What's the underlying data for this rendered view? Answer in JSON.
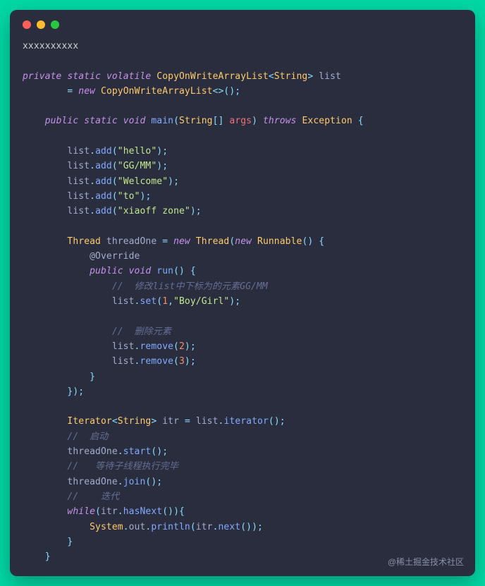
{
  "titlebar": {
    "dots": [
      "red",
      "yellow",
      "green"
    ]
  },
  "watermark": "@稀土掘金技术社区",
  "code": {
    "l1": "xxxxxxxxxx",
    "l2_private": "private",
    "l2_static": "static",
    "l2_volatile": "volatile",
    "l2_type": "CopyOnWriteArrayList",
    "l2_generic": "String",
    "l2_var": "list",
    "l3_new": "new",
    "l3_type": "CopyOnWriteArrayList",
    "l4_public": "public",
    "l4_static": "static",
    "l4_void": "void",
    "l4_main": "main",
    "l4_argtype": "String",
    "l4_argname": "args",
    "l4_throws": "throws",
    "l4_exc": "Exception",
    "add": "add",
    "s_hello": "\"hello\"",
    "s_ggmm": "\"GG/MM\"",
    "s_welcome": "\"Welcome\"",
    "s_to": "\"to\"",
    "s_xiaoff": "\"xiaoff zone\"",
    "thread_type": "Thread",
    "thread_var": "threadOne",
    "runnable": "Runnable",
    "override": "@Override",
    "run": "run",
    "cmt_modify": "//  修改list中下标为的元素GG/MM",
    "set": "set",
    "n1": "1",
    "s_boygirl": "\"Boy/Girl\"",
    "cmt_remove": "//  删除元素",
    "remove": "remove",
    "n2": "2",
    "n3": "3",
    "iter_type": "Iterator",
    "iter_var": "itr",
    "iterator": "iterator",
    "cmt_start": "//  启动",
    "start": "start",
    "cmt_wait": "//   等待子线程执行完毕",
    "join": "join",
    "cmt_iter": "//    迭代",
    "while": "while",
    "hasnext": "hasNext",
    "system": "System",
    "out": "out",
    "println": "println",
    "next": "next",
    "list": "list"
  }
}
